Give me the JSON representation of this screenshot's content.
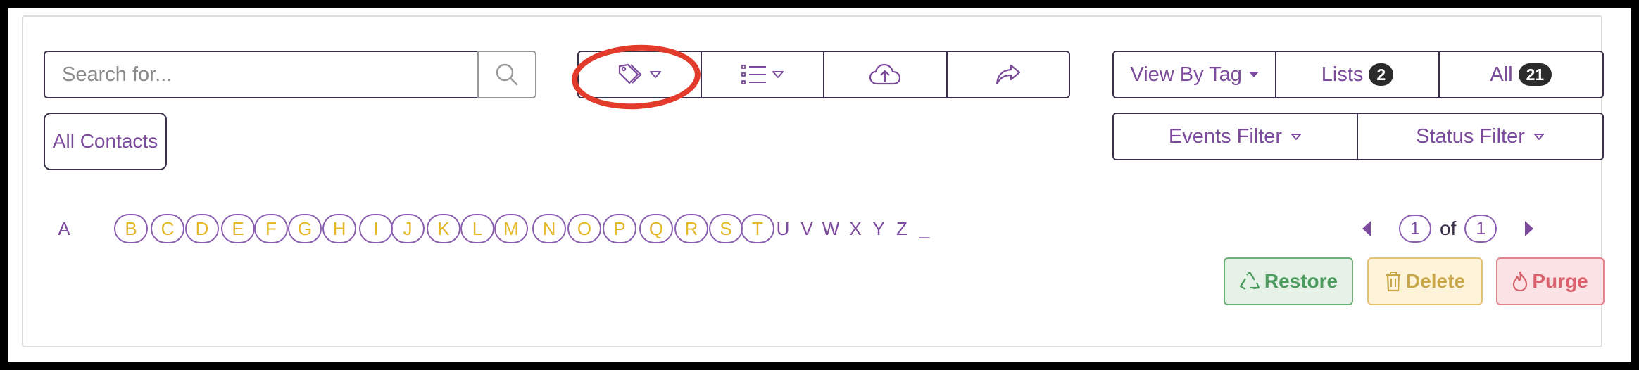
{
  "search": {
    "placeholder": "Search for...",
    "value": "",
    "icon": "search-icon"
  },
  "toolbar": {
    "icons": [
      "tag-icon",
      "list-icon",
      "cloud-upload-icon",
      "share-icon"
    ]
  },
  "view_buttons": {
    "view_by_tag": "View By Tag",
    "lists_label": "Lists",
    "lists_count": "2",
    "all_label": "All",
    "all_count": "21"
  },
  "filters": {
    "events": "Events Filter",
    "status": "Status Filter"
  },
  "all_contacts": "All Contacts",
  "alphabet": [
    {
      "l": "A",
      "on": false
    },
    {
      "l": "B",
      "on": true
    },
    {
      "l": "C",
      "on": true
    },
    {
      "l": "D",
      "on": true
    },
    {
      "l": "E",
      "on": true
    },
    {
      "l": "F",
      "on": true
    },
    {
      "l": "G",
      "on": true
    },
    {
      "l": "H",
      "on": true
    },
    {
      "l": "I",
      "on": true
    },
    {
      "l": "J",
      "on": true
    },
    {
      "l": "K",
      "on": true
    },
    {
      "l": "L",
      "on": true
    },
    {
      "l": "M",
      "on": true
    },
    {
      "l": "N",
      "on": true
    },
    {
      "l": "O",
      "on": true
    },
    {
      "l": "P",
      "on": true
    },
    {
      "l": "Q",
      "on": true
    },
    {
      "l": "R",
      "on": true
    },
    {
      "l": "S",
      "on": true
    },
    {
      "l": "T",
      "on": true
    },
    {
      "l": "U",
      "on": false
    },
    {
      "l": "V",
      "on": false
    },
    {
      "l": "W",
      "on": false
    },
    {
      "l": "X",
      "on": false
    },
    {
      "l": "Y",
      "on": false
    },
    {
      "l": "Z",
      "on": false
    },
    {
      "l": "_",
      "on": false
    }
  ],
  "pagination": {
    "current": "1",
    "of_label": "of",
    "total": "1"
  },
  "actions": {
    "restore": "Restore",
    "delete": "Delete",
    "purge": "Purge"
  },
  "colors": {
    "accent": "#7b4a9c",
    "letter_active": "#e3b92b",
    "annotation": "#e33b2b",
    "restore": "#4d9a5f",
    "delete": "#c8a64a",
    "purge": "#d9606c"
  }
}
